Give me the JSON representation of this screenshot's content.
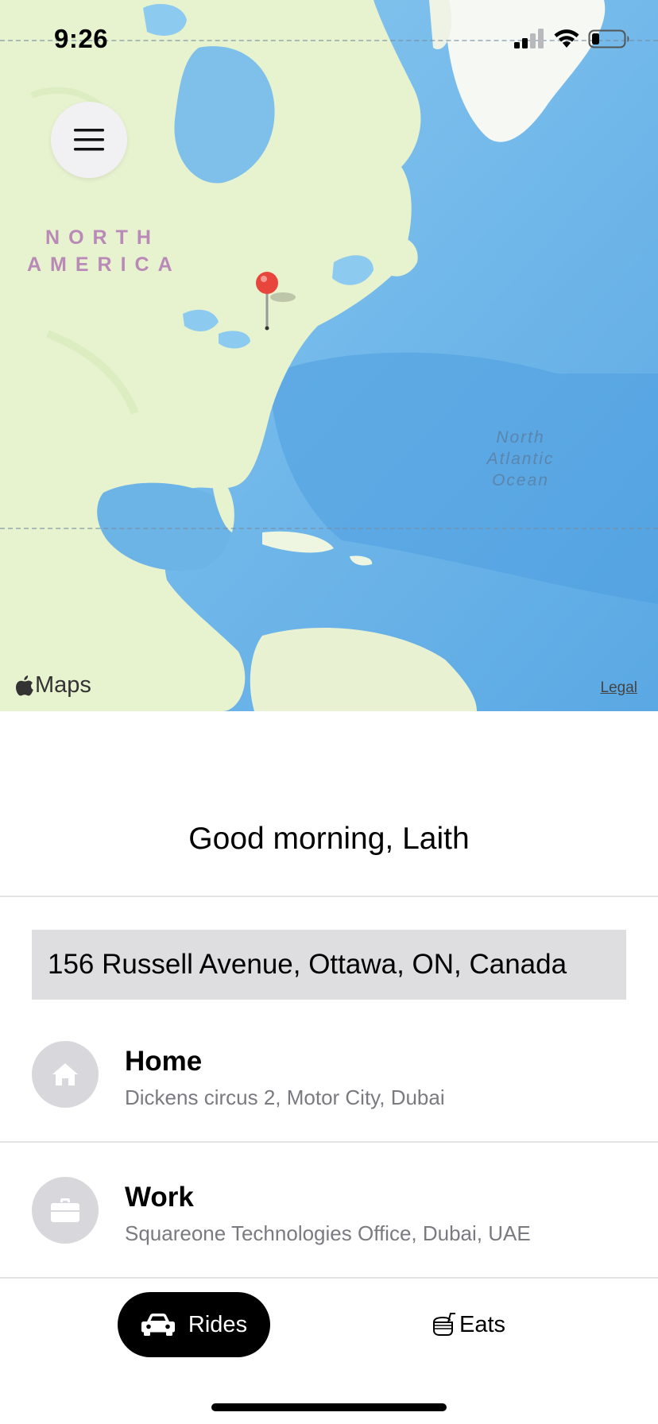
{
  "status_bar": {
    "time": "9:26"
  },
  "map": {
    "continent_label_line1": "NORTH",
    "continent_label_line2": "AMERICA",
    "ocean_label_line1": "North",
    "ocean_label_line2": "Atlantic",
    "ocean_label_line3": "Ocean",
    "brand": "Maps",
    "legal_link": "Legal"
  },
  "sheet": {
    "greeting": "Good morning, Laith",
    "current_address": "156 Russell Avenue, Ottawa, ON, Canada",
    "saved_places": [
      {
        "title": "Home",
        "subtitle": "Dickens circus 2, Motor City, Dubai",
        "icon": "home-icon"
      },
      {
        "title": "Work",
        "subtitle": "Squareone Technologies Office, Dubai, UAE",
        "icon": "briefcase-icon"
      }
    ]
  },
  "tabs": {
    "rides_label": "Rides",
    "eats_label": "Eats",
    "selected": "Rides"
  },
  "colors": {
    "pin": "#e8453c",
    "selected_tab_bg": "#000000",
    "address_bg": "#dedee0",
    "place_icon_bg": "#d7d7dc"
  }
}
